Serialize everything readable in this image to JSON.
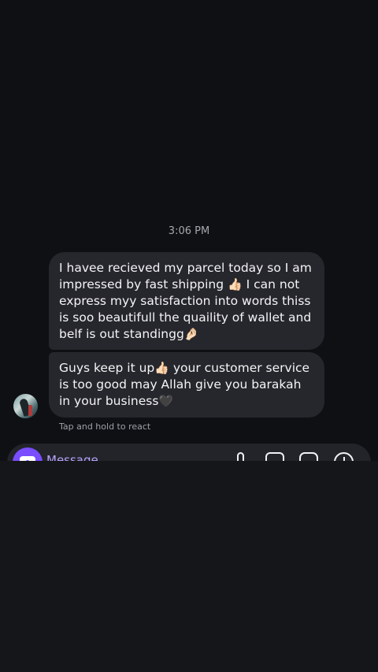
{
  "conversation": {
    "timestamp": "3:06 PM",
    "messages": [
      {
        "text_a": "I havee recieved my parcel today so I am impressed by fast shipping ",
        "emoji_a": "👍🏻",
        "text_b": " I can not express myy satisfaction into words thiss is soo beautifull the quaility of wallet and belf is out standingg",
        "emoji_b": "🤌🏻"
      },
      {
        "text_a": "Guys keep it up",
        "emoji_a": "👍🏻",
        "text_b": " your customer service is too good may Allah give you barakah in your business",
        "emoji_b": "🖤"
      }
    ],
    "react_hint": "Tap and hold to react"
  },
  "composer": {
    "placeholder": "Message",
    "icons": [
      "camera-icon",
      "mic-icon",
      "gallery-icon",
      "sticker-icon",
      "plus-icon"
    ],
    "accent_color": "#7a4dff"
  },
  "colors": {
    "background": "#0e1014",
    "bubble": "#26272d",
    "hint_text": "#9ea0a6"
  }
}
